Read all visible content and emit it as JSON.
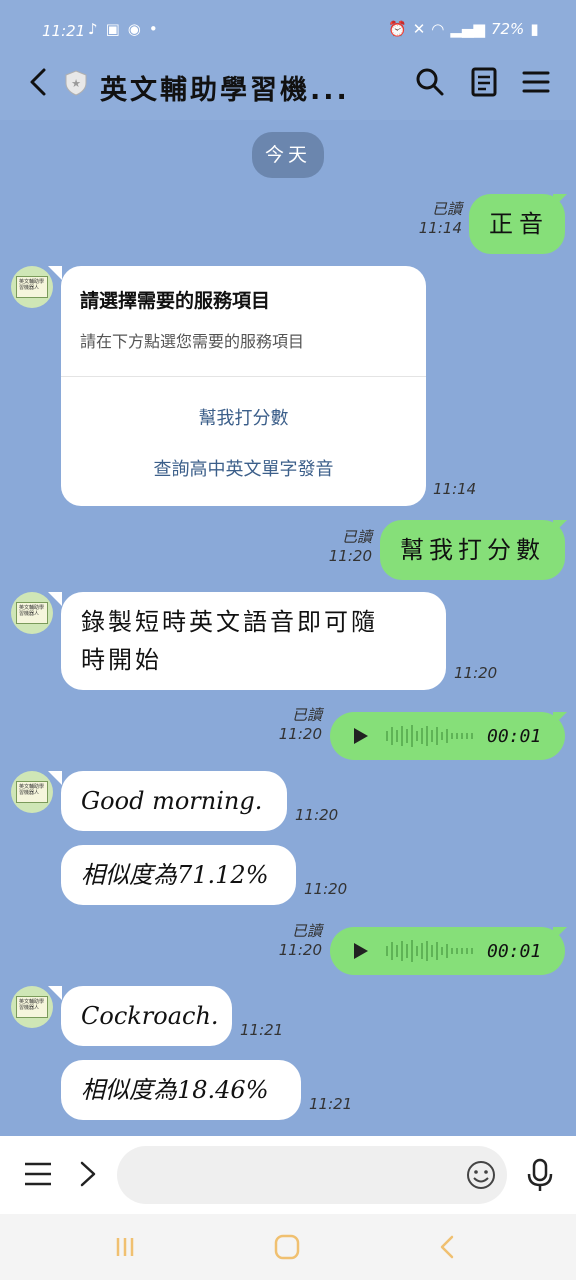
{
  "status_bar": {
    "time": "11:21",
    "battery": "72%"
  },
  "header": {
    "title": "英文輔助學習機..."
  },
  "chat": {
    "date_chip": "今天",
    "read_label": "已讀",
    "msg1": {
      "text": "正音",
      "time": "11:14"
    },
    "card": {
      "title": "請選擇需要的服務項目",
      "subtitle": "請在下方點選您需要的服務項目",
      "option1": "幫我打分數",
      "option2": "查詢高中英文單字發音",
      "time": "11:14"
    },
    "msg2": {
      "text": "幫我打分數",
      "time": "11:20"
    },
    "msg3": {
      "line1": "錄製短時英文語音即可隨",
      "line2": "時開始",
      "time": "11:20"
    },
    "voice1": {
      "duration": "00:01",
      "time": "11:20"
    },
    "msg4": {
      "text": "Good morning.",
      "time": "11:20"
    },
    "msg5": {
      "text": "相似度為71.12%",
      "time": "11:20"
    },
    "voice2": {
      "duration": "00:01",
      "time": "11:20"
    },
    "msg6": {
      "text": "Cockroach.",
      "time": "11:21"
    },
    "msg7": {
      "text": "相似度為18.46%",
      "time": "11:21"
    }
  },
  "avatar_text": "英文輔助學習機器人",
  "input": {
    "placeholder": ""
  }
}
